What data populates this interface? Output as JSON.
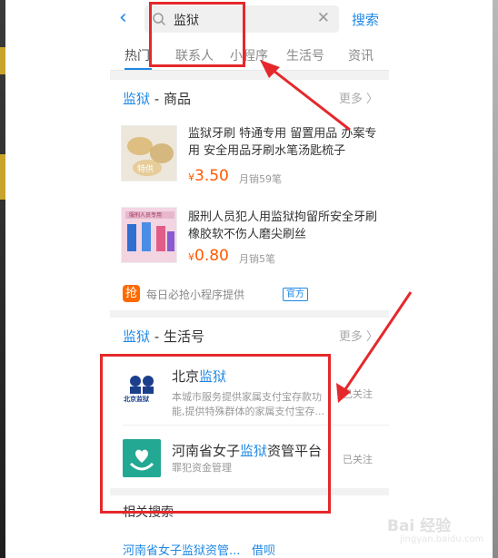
{
  "header": {
    "back_icon": "back-arrow-icon",
    "search_query": "监狱",
    "search_button": "搜索"
  },
  "tabs": [
    {
      "label": "热门"
    },
    {
      "label": "联系人"
    },
    {
      "label": "小程序"
    },
    {
      "label": "生活号"
    },
    {
      "label": "资讯"
    }
  ],
  "goods_section": {
    "keyword": "监狱",
    "title_suffix": " - 商品",
    "more": "更多 〉",
    "products": [
      {
        "title": "监狱牙刷 特通专用 留置用品 办案专用 安全用品牙刷水笔汤匙梳子",
        "currency": "¥",
        "price": "3.50",
        "sales": "月销59笔",
        "image_caption": "特供"
      },
      {
        "title": "服刑人员犯人用监狱拘留所安全牙刷橡胶软不伤人磨尖刷丝",
        "currency": "¥",
        "price": "0.80",
        "sales": "月销5笔",
        "image_caption": "服刑人员专用"
      }
    ],
    "mini_logo": "抢",
    "mini_provider": "每日必抢小程序提供",
    "official_badge": "官方"
  },
  "life_section": {
    "keyword": "监狱",
    "title_suffix": " - 生活号",
    "more": "更多 〉",
    "accounts": [
      {
        "name_pre": "北京",
        "name_kw": "监狱",
        "name_post": "",
        "desc": "本城市服务提供家属支付宝存款功能,提供特殊群体的家属支付宝存...",
        "status": "已关注",
        "logo_text": "北京监狱"
      },
      {
        "name_pre": "河南省女子",
        "name_kw": "监狱",
        "name_post": "资管平台",
        "desc": "罪犯资金管理",
        "status": "已关注"
      }
    ]
  },
  "related": {
    "title": "相关搜索",
    "links": [
      "河南省女子监狱资管...",
      "借呗"
    ]
  },
  "colors": {
    "accent": "#1e88e5",
    "price": "#ff5a00",
    "highlight": "#e5282c"
  },
  "watermark": {
    "text": "Bai 经验",
    "sub": "jingyan.baidu.com"
  }
}
